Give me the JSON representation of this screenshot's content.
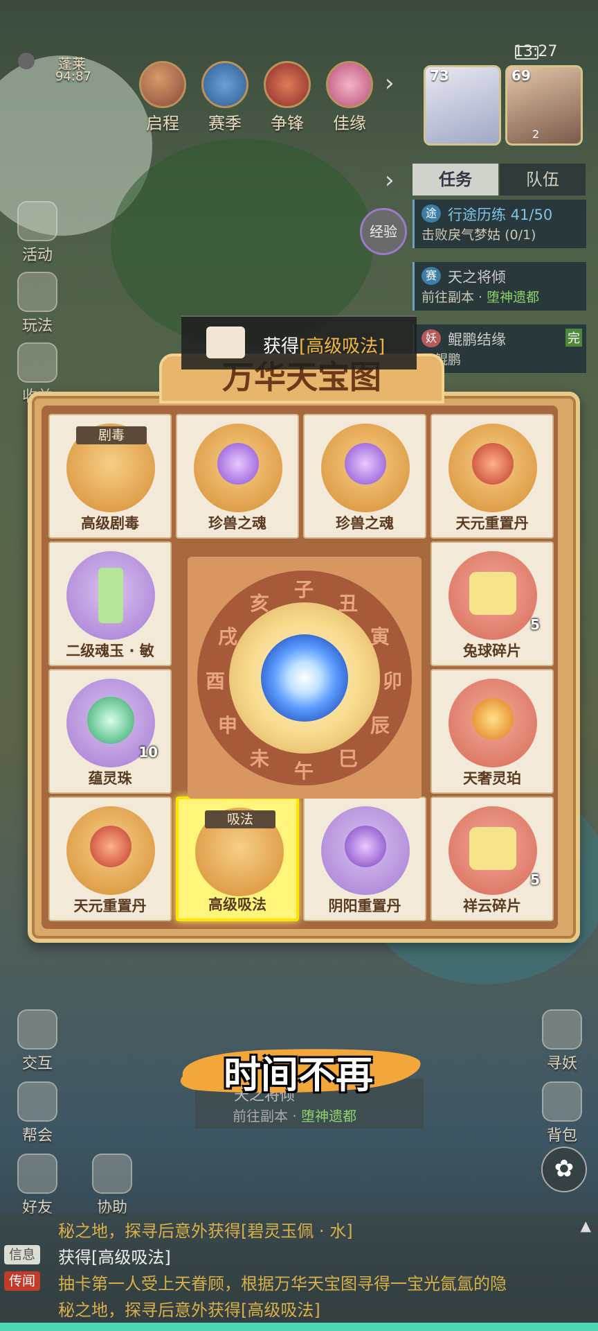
{
  "status_bar": {
    "time": "13:27"
  },
  "location": {
    "name": "蓬莱",
    "code": "94:87"
  },
  "top_menu": [
    {
      "label": "启程",
      "icon": "scroll-icon"
    },
    {
      "label": "赛季",
      "icon": "season-icon"
    },
    {
      "label": "争锋",
      "icon": "battle-icon"
    },
    {
      "label": "佳缘",
      "icon": "bond-icon"
    }
  ],
  "team": [
    {
      "level": "73"
    },
    {
      "level": "69",
      "badge": "2"
    }
  ],
  "quest_tabs": {
    "task": "任务",
    "team": "队伍"
  },
  "exp_label": "经验",
  "quests": [
    {
      "badge": "途",
      "title": "行途历练 41/50",
      "sub": "击败戾气梦姑",
      "progress": "(0/1)"
    },
    {
      "badge": "赛",
      "title": "天之将倾",
      "sub_prefix": "前往副本 · ",
      "sub_link": "堕神遗都"
    },
    {
      "badge": "妖",
      "title": "鲲鹏结缘",
      "done": "完",
      "sub": "寻鲲鹏"
    }
  ],
  "left_side": [
    {
      "label": "活动"
    },
    {
      "label": "玩法"
    },
    {
      "label": "收益"
    }
  ],
  "toast": {
    "prefix": "获得",
    "item": "[高级吸法]"
  },
  "board": {
    "title": "万华天宝图",
    "cells": [
      {
        "name": "高级剧毒",
        "tag": "剧毒",
        "disc": "gold"
      },
      {
        "name": "珍兽之魂",
        "disc": "gold"
      },
      {
        "name": "珍兽之魂",
        "disc": "gold"
      },
      {
        "name": "天元重置丹",
        "disc": "gold"
      },
      {
        "name": "二级魂玉 · 敏",
        "disc": "purple"
      },
      {
        "name": "兔球碎片",
        "disc": "red",
        "count": "5"
      },
      {
        "name": "蕴灵珠",
        "disc": "purple",
        "count": "10"
      },
      {
        "name": "天奢灵珀",
        "disc": "red"
      },
      {
        "name": "天元重置丹",
        "disc": "gold"
      },
      {
        "name": "高级吸法",
        "tag": "吸法",
        "disc": "gold",
        "selected": true
      },
      {
        "name": "阴阳重置丹",
        "disc": "purple"
      },
      {
        "name": "祥云碎片",
        "disc": "red",
        "count": "5"
      }
    ],
    "zodiac": [
      "子",
      "丑",
      "寅",
      "卯",
      "辰",
      "巳",
      "午",
      "未",
      "申",
      "酉",
      "戌",
      "亥"
    ]
  },
  "subtitle": "时间不再",
  "bottom_quest": {
    "title": "天之将倾",
    "sub_prefix": "前往副本 · ",
    "sub_link": "堕神遗都"
  },
  "bottom_left": [
    {
      "label": "交互"
    },
    {
      "label": "帮会"
    },
    {
      "label": "好友"
    },
    {
      "label": "协助"
    }
  ],
  "bottom_right": [
    {
      "label": "寻妖"
    },
    {
      "label": "背包"
    }
  ],
  "chat": {
    "line1": "秘之地，探寻后意外获得[碧灵玉佩 · 水]",
    "line2_tag": "信息",
    "line2": "获得[高级吸法]",
    "line3_tag": "传闻",
    "line3": "抽卡第一人受上天眷顾，根据万华天宝图寻得一宝光氤氲的隐",
    "line4": "秘之地，探寻后意外获得[高级吸法]"
  },
  "colors": {
    "accent": "#f3b541",
    "selected": "#fff57a",
    "board": "#d9a868"
  }
}
